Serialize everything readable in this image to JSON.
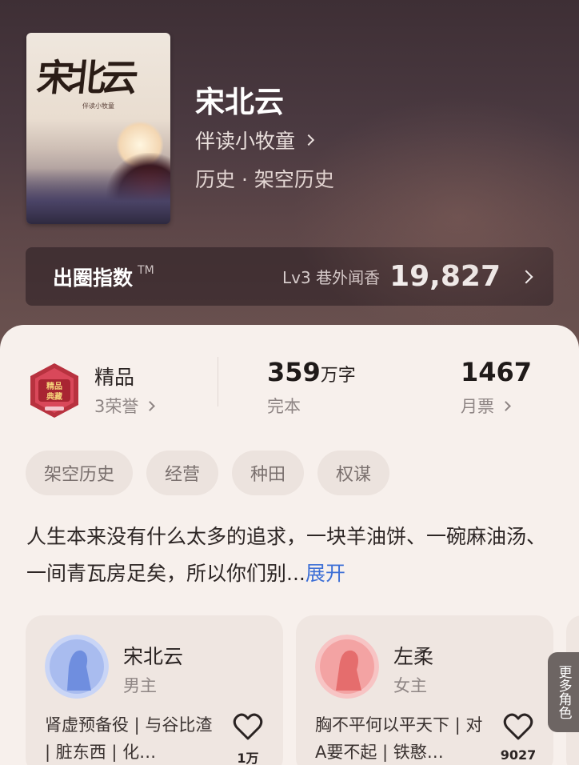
{
  "book": {
    "cover_title": "宋北云",
    "cover_author": "伴读小牧童",
    "title": "宋北云",
    "author": "伴读小牧童",
    "genre": "历史 · 架空历史"
  },
  "index": {
    "title": "出圈指数",
    "tm": "TM",
    "level": "Lv3 巷外闻香",
    "value": "19,827"
  },
  "stats": {
    "quality": "精品",
    "honors": "3荣誉",
    "word_count": "359",
    "word_unit": "万字",
    "status": "完本",
    "monthly_votes": "1467",
    "monthly_label": "月票"
  },
  "tags": [
    "架空历史",
    "经营",
    "种田",
    "权谋"
  ],
  "description": {
    "text": "人生本来没有什么太多的追求，一块羊油饼、一碗麻油汤、一间青瓦房足矣，所以你们别...",
    "expand": "展开"
  },
  "roles": [
    {
      "name": "宋北云",
      "type": "男主",
      "desc": "肾虚预备役 | 与谷比渣 | 脏东西 | 化…",
      "likes": "1万",
      "color": "#8ea6e6"
    },
    {
      "name": "左柔",
      "type": "女主",
      "desc": "胸不平何以平天下 | 对A要不起 | 铁憨…",
      "likes": "9027",
      "color": "#ef8b8b"
    }
  ],
  "more_roles": "更多角色"
}
